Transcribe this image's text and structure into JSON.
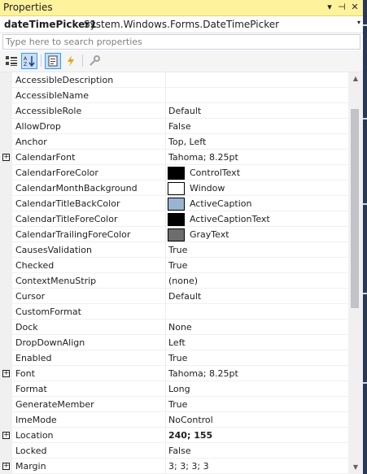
{
  "window": {
    "title": "Properties",
    "dropdown_glyph": "▾",
    "pin_glyph": "⊣",
    "close_glyph": "✕"
  },
  "object_selector": {
    "name": "dateTimePicker1",
    "type": "System.Windows.Forms.DateTimePicker",
    "dropdown_glyph": "▾"
  },
  "search": {
    "placeholder": "Type here to search properties",
    "value": ""
  },
  "toolbar": {
    "icons": [
      "categorized-icon",
      "alphabetical-icon",
      "properties-icon",
      "events-icon",
      "property-pages-icon"
    ]
  },
  "colors": {
    "title_bar": "#fff29d",
    "toolbar_active": "#c9def5",
    "swatch_black": "#000000",
    "swatch_white": "#ffffff",
    "swatch_active_caption": "#99b4d1",
    "swatch_gray_text": "#6d6d6d"
  },
  "properties": [
    {
      "name": "AccessibleDescription",
      "value": ""
    },
    {
      "name": "AccessibleName",
      "value": ""
    },
    {
      "name": "AccessibleRole",
      "value": "Default"
    },
    {
      "name": "AllowDrop",
      "value": "False"
    },
    {
      "name": "Anchor",
      "value": "Top, Left"
    },
    {
      "name": "CalendarFont",
      "value": "Tahoma; 8.25pt",
      "expandable": true
    },
    {
      "name": "CalendarForeColor",
      "value": "ControlText",
      "swatch": "#000000"
    },
    {
      "name": "CalendarMonthBackground",
      "value": "Window",
      "swatch": "#ffffff"
    },
    {
      "name": "CalendarTitleBackColor",
      "value": "ActiveCaption",
      "swatch": "#99b4d1"
    },
    {
      "name": "CalendarTitleForeColor",
      "value": "ActiveCaptionText",
      "swatch": "#000000"
    },
    {
      "name": "CalendarTrailingForeColor",
      "value": "GrayText",
      "swatch": "#6d6d6d"
    },
    {
      "name": "CausesValidation",
      "value": "True"
    },
    {
      "name": "Checked",
      "value": "True"
    },
    {
      "name": "ContextMenuStrip",
      "value": "(none)"
    },
    {
      "name": "Cursor",
      "value": "Default"
    },
    {
      "name": "CustomFormat",
      "value": ""
    },
    {
      "name": "Dock",
      "value": "None"
    },
    {
      "name": "DropDownAlign",
      "value": "Left"
    },
    {
      "name": "Enabled",
      "value": "True"
    },
    {
      "name": "Font",
      "value": "Tahoma; 8.25pt",
      "expandable": true
    },
    {
      "name": "Format",
      "value": "Long"
    },
    {
      "name": "GenerateMember",
      "value": "True"
    },
    {
      "name": "ImeMode",
      "value": "NoControl"
    },
    {
      "name": "Location",
      "value": "240; 155",
      "expandable": true,
      "bold": true
    },
    {
      "name": "Locked",
      "value": "False"
    },
    {
      "name": "Margin",
      "value": "3; 3; 3; 3",
      "expandable": true
    }
  ],
  "scrollbar": {
    "up_glyph": "▲",
    "down_glyph": "▼"
  }
}
